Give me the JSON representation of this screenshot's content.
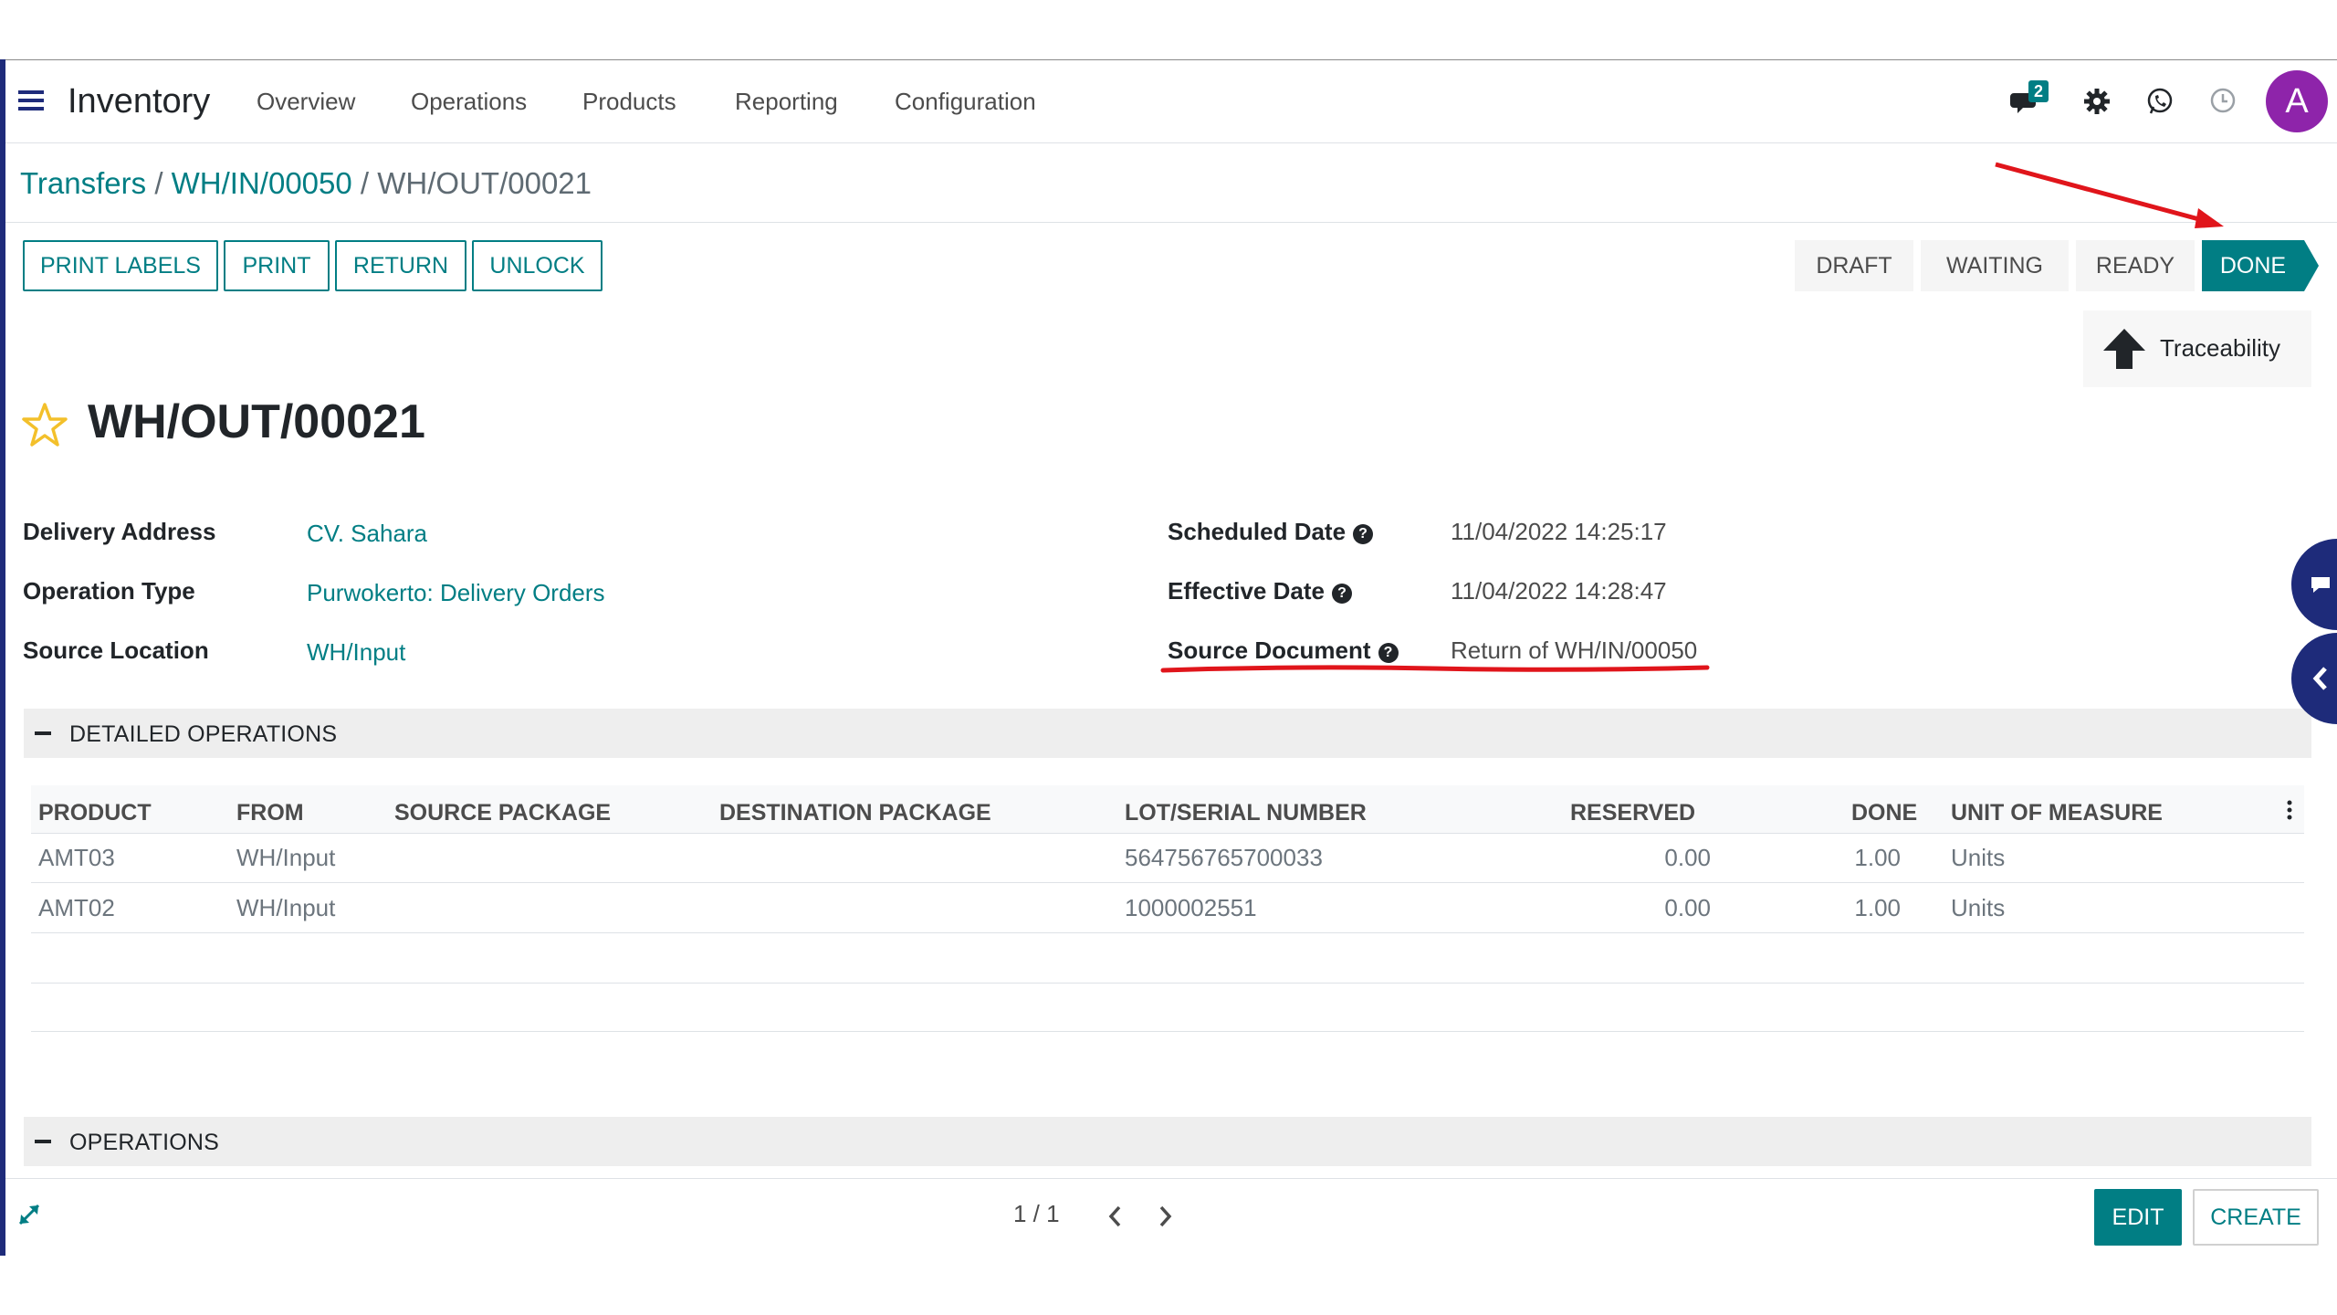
{
  "navbar": {
    "app_title": "Inventory",
    "menus": [
      "Overview",
      "Operations",
      "Products",
      "Reporting",
      "Configuration"
    ],
    "messages_badge": "2",
    "avatar_initial": "A"
  },
  "breadcrumb": {
    "items": [
      "Transfers",
      "WH/IN/00050",
      "WH/OUT/00021"
    ],
    "separator": "/"
  },
  "actions": {
    "print_labels": "PRINT LABELS",
    "print": "PRINT",
    "return": "RETURN",
    "unlock": "UNLOCK"
  },
  "statusbar": {
    "stages": [
      "DRAFT",
      "WAITING",
      "READY",
      "DONE"
    ],
    "active": "DONE"
  },
  "smart_button": {
    "traceability": "Traceability"
  },
  "record": {
    "title": "WH/OUT/00021"
  },
  "fields_left": [
    {
      "label": "Delivery Address",
      "value": "CV. Sahara"
    },
    {
      "label": "Operation Type",
      "value": "Purwokerto: Delivery Orders"
    },
    {
      "label": "Source Location",
      "value": "WH/Input"
    }
  ],
  "fields_right": [
    {
      "label": "Scheduled Date",
      "value": "11/04/2022 14:25:17"
    },
    {
      "label": "Effective Date",
      "value": "11/04/2022 14:28:47"
    },
    {
      "label": "Source Document",
      "value": "Return of WH/IN/00050"
    }
  ],
  "detailed_operations": {
    "section_title": "DETAILED OPERATIONS",
    "columns": [
      "PRODUCT",
      "FROM",
      "SOURCE PACKAGE",
      "DESTINATION PACKAGE",
      "LOT/SERIAL NUMBER",
      "RESERVED",
      "DONE",
      "UNIT OF MEASURE"
    ],
    "rows": [
      {
        "product": "AMT03",
        "from": "WH/Input",
        "source_package": "",
        "destination_package": "",
        "lot": "564756765700033",
        "reserved": "0.00",
        "done": "1.00",
        "uom": "Units"
      },
      {
        "product": "AMT02",
        "from": "WH/Input",
        "source_package": "",
        "destination_package": "",
        "lot": "1000002551",
        "reserved": "0.00",
        "done": "1.00",
        "uom": "Units"
      }
    ]
  },
  "operations_section": {
    "title": "OPERATIONS"
  },
  "footer": {
    "pager": "1 / 1",
    "edit": "EDIT",
    "create": "CREATE"
  },
  "colors": {
    "accent": "#017e84",
    "annotation_red": "#e0151b",
    "avatar_purple": "#8e24aa",
    "side_tab": "#1e2b7a"
  }
}
